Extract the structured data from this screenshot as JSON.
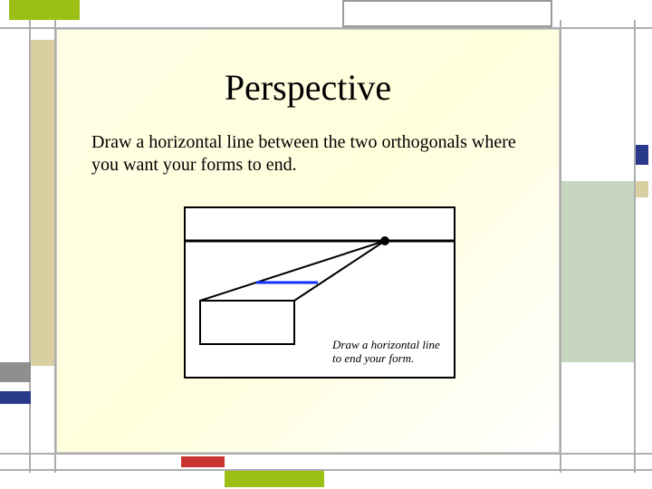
{
  "slide": {
    "title": "Perspective",
    "body": "Draw a horizontal line between the two orthogonals where you want your forms to end.",
    "figure_caption": "Draw a horizontal line to end your form."
  },
  "colors": {
    "accent_green": "#9bbf14",
    "accent_blue": "#2a3a8a",
    "accent_red": "#c9352e",
    "accent_tan": "#d9cfa0",
    "accent_sage": "#c7d7bf"
  }
}
